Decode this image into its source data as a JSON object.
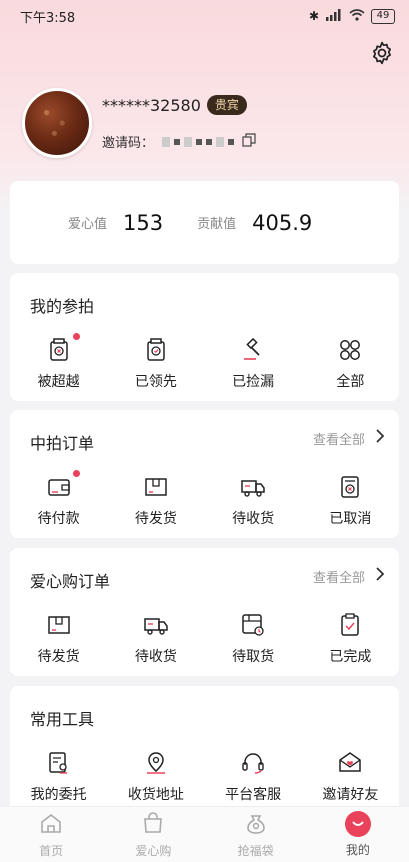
{
  "status_bar": {
    "time": "下午3:58",
    "battery": "49"
  },
  "profile": {
    "username": "******32580",
    "vip_badge": "贵宾",
    "invite_label": "邀请码："
  },
  "stats": {
    "love_label": "爱心值",
    "love_value": "153",
    "contrib_label": "贡献值",
    "contrib_value": "405.9"
  },
  "my_bids": {
    "title": "我的参拍",
    "items": [
      {
        "label": "被超越",
        "icon": "auction-doc-icon",
        "has_dot": true
      },
      {
        "label": "已领先",
        "icon": "auction-doc-icon",
        "has_dot": false
      },
      {
        "label": "已捡漏",
        "icon": "gavel-icon",
        "has_dot": false
      },
      {
        "label": "全部",
        "icon": "grid-icon",
        "has_dot": false
      }
    ]
  },
  "won_orders": {
    "title": "中拍订单",
    "see_all": "查看全部",
    "items": [
      {
        "label": "待付款",
        "icon": "wallet-icon",
        "has_dot": true
      },
      {
        "label": "待发货",
        "icon": "box-icon",
        "has_dot": false
      },
      {
        "label": "待收货",
        "icon": "truck-icon",
        "has_dot": false
      },
      {
        "label": "已取消",
        "icon": "cancel-doc-icon",
        "has_dot": false
      }
    ]
  },
  "love_orders": {
    "title": "爱心购订单",
    "see_all": "查看全部",
    "items": [
      {
        "label": "待发货",
        "icon": "box-icon"
      },
      {
        "label": "待收货",
        "icon": "truck-icon"
      },
      {
        "label": "待取货",
        "icon": "pickup-icon"
      },
      {
        "label": "已完成",
        "icon": "clipboard-check-icon"
      }
    ]
  },
  "tools": {
    "title": "常用工具",
    "items": [
      {
        "label": "我的委托",
        "icon": "entrust-icon"
      },
      {
        "label": "收货地址",
        "icon": "location-icon"
      },
      {
        "label": "平台客服",
        "icon": "headset-icon"
      },
      {
        "label": "邀请好友",
        "icon": "invite-mail-icon"
      }
    ]
  },
  "bottom_nav": [
    {
      "label": "首页",
      "icon": "home-icon"
    },
    {
      "label": "爱心购",
      "icon": "shopping-bag-icon"
    },
    {
      "label": "抢福袋",
      "icon": "lucky-bag-icon"
    },
    {
      "label": "我的",
      "icon": "profile-icon",
      "active": true
    }
  ],
  "colors": {
    "accent": "#e8435a",
    "badge_bg": "#3a2a1e",
    "badge_text": "#f2d9a8"
  }
}
